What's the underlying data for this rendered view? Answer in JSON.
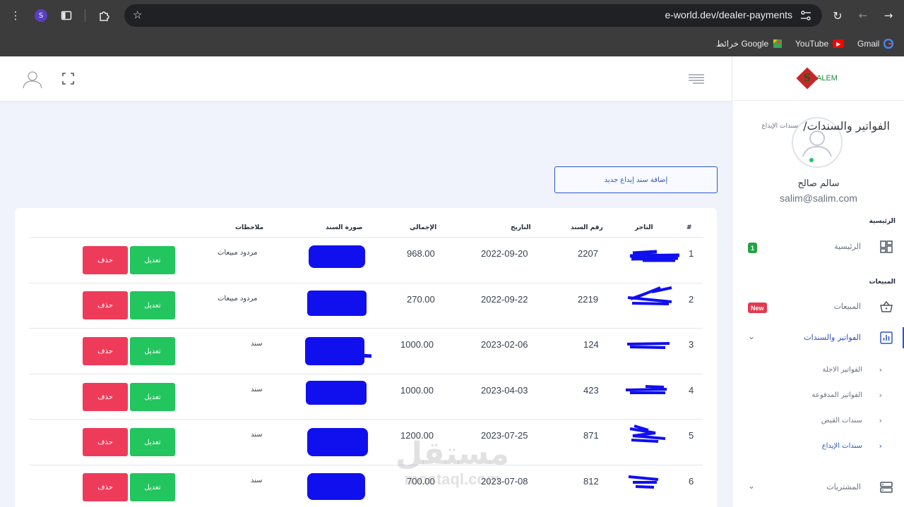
{
  "browser": {
    "url": "e-world.dev/dealer-payments",
    "profile_initial": "S",
    "bookmarks": [
      {
        "label": "Gmail",
        "icon": "gmail-icon"
      },
      {
        "label": "YouTube",
        "icon": "youtube-icon"
      },
      {
        "label": "خرائط Google",
        "icon": "google-maps-icon"
      }
    ]
  },
  "sidebar": {
    "logo_letter": "S",
    "logo_text": "ALEM",
    "user_name": "سالم صالح",
    "user_email": "salim@salim.com",
    "section_main": "الرئيسية",
    "home_label": "الرئيسية",
    "home_badge": "1",
    "section_sales": "المبيعات",
    "sales_label": "المبيعات",
    "sales_badge": "New",
    "invoices_label": "الفواتير والسندات",
    "sub_items": [
      "الفواتير الاجلة",
      "الفواتير المدفوعة",
      "سندات القبض",
      "سندات الإيداع"
    ],
    "purchases_label": "المشتريات"
  },
  "page": {
    "title": "الفواتير والسندات/",
    "breadcrumb": "سندات الإيداع",
    "add_button": "إضافة سند إيداع جديد"
  },
  "table": {
    "headers": {
      "num": "#",
      "merchant": "التاجر",
      "voucher_no": "رقم السند",
      "date": "التاريخ",
      "total": "الإجمالي",
      "image": "صورة السند",
      "notes": "ملاحظات"
    },
    "edit_label": "تعديل",
    "delete_label": "حذف",
    "rows": [
      {
        "num": "1",
        "voucher_no": "2207",
        "date": "2022-09-20",
        "total": "968.00",
        "notes": "مردود مبيعات"
      },
      {
        "num": "2",
        "voucher_no": "2219",
        "date": "2022-09-22",
        "total": "270.00",
        "notes": "مردود مبيعات"
      },
      {
        "num": "3",
        "voucher_no": "124",
        "date": "2023-02-06",
        "total": "1000.00",
        "notes": "سند"
      },
      {
        "num": "4",
        "voucher_no": "423",
        "date": "2023-04-03",
        "total": "1000.00",
        "notes": "سند"
      },
      {
        "num": "5",
        "voucher_no": "871",
        "date": "2023-07-25",
        "total": "1200.00",
        "notes": "سند"
      },
      {
        "num": "6",
        "voucher_no": "812",
        "date": "2023-07-08",
        "total": "700.00",
        "notes": "سند"
      }
    ]
  },
  "watermark": {
    "line1": "مستقل",
    "line2": "mostaql.com"
  },
  "colors": {
    "accent": "#2b56c6",
    "edit": "#22c55e",
    "delete": "#ef3b5a",
    "redaction": "#1010ee"
  }
}
